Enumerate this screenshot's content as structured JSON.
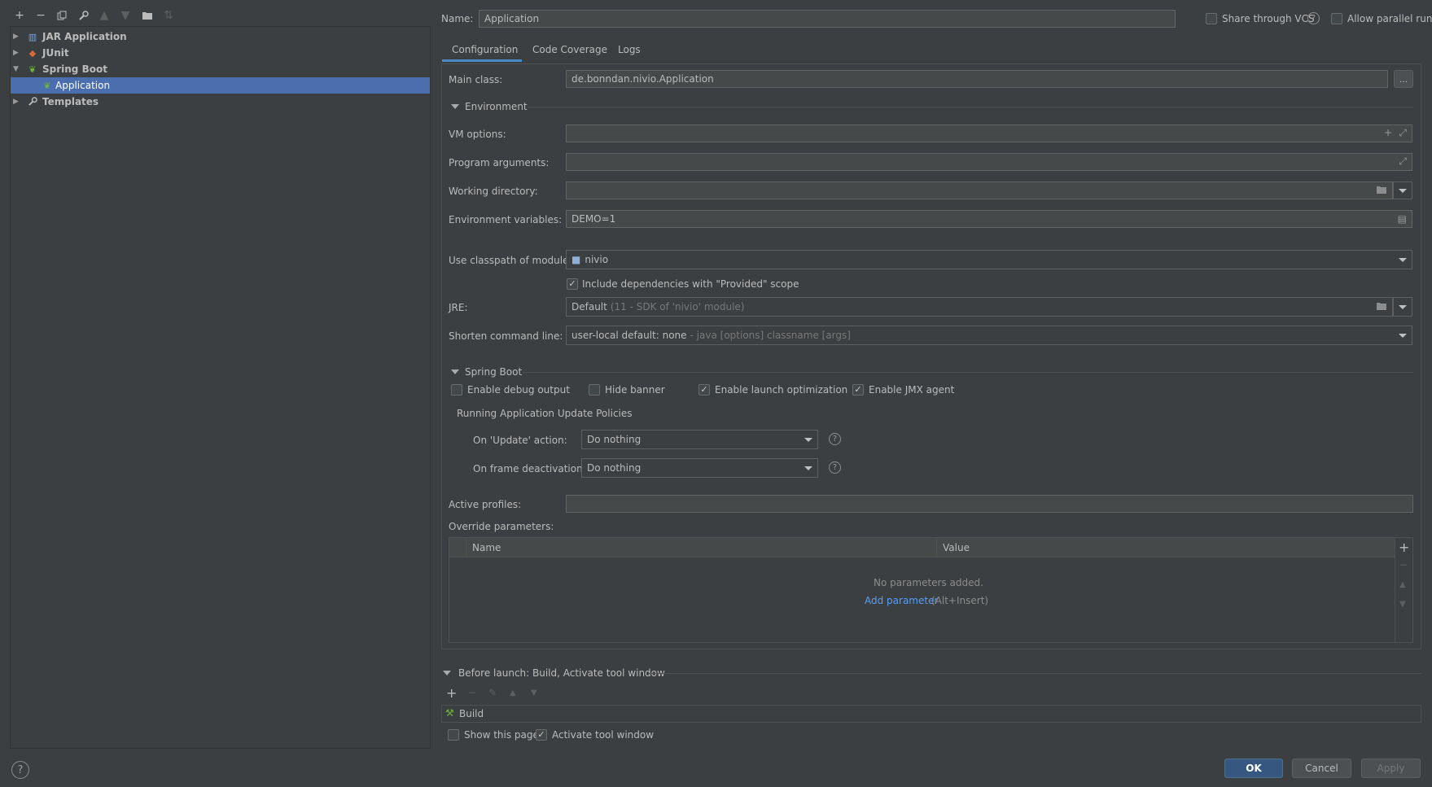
{
  "toolbar": {
    "icons": [
      "add-icon",
      "remove-icon",
      "copy-icon",
      "wrench-icon",
      "move-up-icon",
      "move-down-icon",
      "folder-icon",
      "sort-icon"
    ]
  },
  "tree": {
    "jar": "JAR Application",
    "junit": "JUnit",
    "spring": "Spring Boot",
    "app": "Application",
    "templates": "Templates"
  },
  "header": {
    "name_label": "Name:",
    "name_value": "Application",
    "share_vcs": "Share through VCS",
    "allow_parallel": "Allow parallel run"
  },
  "tabs": [
    "Configuration",
    "Code Coverage",
    "Logs"
  ],
  "config": {
    "main_class_label": "Main class:",
    "main_class_value": "de.bonndan.nivio.Application",
    "browse": "...",
    "environment_section": "Environment",
    "vm_options_label": "VM options:",
    "program_args_label": "Program arguments:",
    "working_dir_label": "Working directory:",
    "env_vars_label": "Environment variables:",
    "env_vars_value": "DEMO=1",
    "classpath_label": "Use classpath of module:",
    "classpath_value": "nivio",
    "include_deps": "Include dependencies with \"Provided\" scope",
    "jre_label": "JRE:",
    "jre_value": "Default",
    "jre_hint": "(11 - SDK of 'nivio' module)",
    "shorten_label": "Shorten command line:",
    "shorten_value": "user-local default: none",
    "shorten_hint": "- java [options] classname [args]",
    "spring_section": "Spring Boot",
    "debug_output": "Enable debug output",
    "hide_banner": "Hide banner",
    "launch_opt": "Enable launch optimization",
    "jmx_agent": "Enable JMX agent",
    "update_policies": "Running Application Update Policies",
    "on_update_label": "On 'Update' action:",
    "on_update_value": "Do nothing",
    "on_frame_label": "On frame deactivation:",
    "on_frame_value": "Do nothing",
    "active_profiles_label": "Active profiles:",
    "override_label": "Override parameters:",
    "col_name": "Name",
    "col_value": "Value",
    "empty_text": "No parameters added.",
    "add_param": "Add parameter",
    "add_param_hint": "(Alt+Insert)"
  },
  "before_launch": {
    "title": "Before launch: Build, Activate tool window",
    "item": "Build",
    "show_page": "Show this page",
    "activate_tool": "Activate tool window"
  },
  "footer": {
    "ok": "OK",
    "cancel": "Cancel",
    "apply": "Apply"
  },
  "colors": {
    "background": "#3c3f41",
    "selection": "#4b6eaf",
    "link": "#589df6",
    "ok_button": "#365880",
    "spring_green": "#6db33f"
  }
}
